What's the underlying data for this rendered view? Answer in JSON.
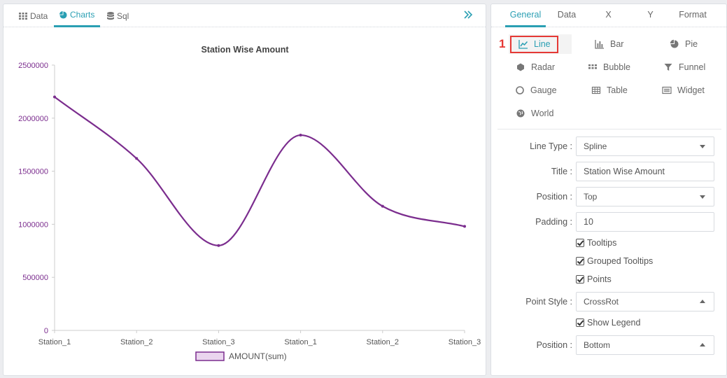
{
  "left_tabs": [
    {
      "label": "Data",
      "icon": "grid-icon"
    },
    {
      "label": "Charts",
      "icon": "pie-chart-icon",
      "active": true
    },
    {
      "label": "Sql",
      "icon": "database-icon"
    }
  ],
  "right_tabs": [
    {
      "label": "General",
      "active": true
    },
    {
      "label": "Data"
    },
    {
      "label": "X"
    },
    {
      "label": "Y"
    },
    {
      "label": "Format"
    }
  ],
  "step_marker": "1",
  "chart_types": [
    {
      "label": "Line",
      "icon": "line-chart-icon",
      "selected": true
    },
    {
      "label": "Bar",
      "icon": "bar-chart-icon"
    },
    {
      "label": "Pie",
      "icon": "pie-chart-icon"
    },
    {
      "label": "Radar",
      "icon": "radar-icon"
    },
    {
      "label": "Bubble",
      "icon": "bubble-icon"
    },
    {
      "label": "Funnel",
      "icon": "funnel-icon"
    },
    {
      "label": "Gauge",
      "icon": "gauge-icon"
    },
    {
      "label": "Table",
      "icon": "table-icon"
    },
    {
      "label": "Widget",
      "icon": "widget-icon"
    },
    {
      "label": "World",
      "icon": "globe-icon"
    }
  ],
  "settings": {
    "line_type_label": "Line Type :",
    "line_type_value": "Spline",
    "title_label": "Title :",
    "title_value": "Station Wise Amount",
    "position_label": "Position :",
    "position_value": "Top",
    "padding_label": "Padding :",
    "padding_value": "10",
    "tooltips_label": "Tooltips",
    "grouped_tooltips_label": "Grouped Tooltips",
    "points_label": "Points",
    "point_style_label": "Point Style :",
    "point_style_value": "CrossRot",
    "show_legend_label": "Show Legend",
    "legend_position_label": "Position :",
    "legend_position_value": "Bottom"
  },
  "colors": {
    "accent": "#2a9fb3",
    "series": "#7b2d8e",
    "legend_fill": "#ead5ee",
    "highlight": "#e53935"
  },
  "chart_data": {
    "type": "line",
    "title": "Station Wise Amount",
    "line_type": "spline",
    "categories": [
      "Station_1",
      "Station_2",
      "Station_3",
      "Station_1",
      "Station_2",
      "Station_3"
    ],
    "series": [
      {
        "name": "AMOUNT(sum)",
        "values": [
          2200000,
          1620000,
          800000,
          1840000,
          1170000,
          980000
        ]
      }
    ],
    "yticks": [
      "0",
      "500000",
      "1000000",
      "1500000",
      "2000000",
      "2500000"
    ],
    "ylim": [
      0,
      2500000
    ],
    "legend_position": "bottom",
    "grid": false
  }
}
